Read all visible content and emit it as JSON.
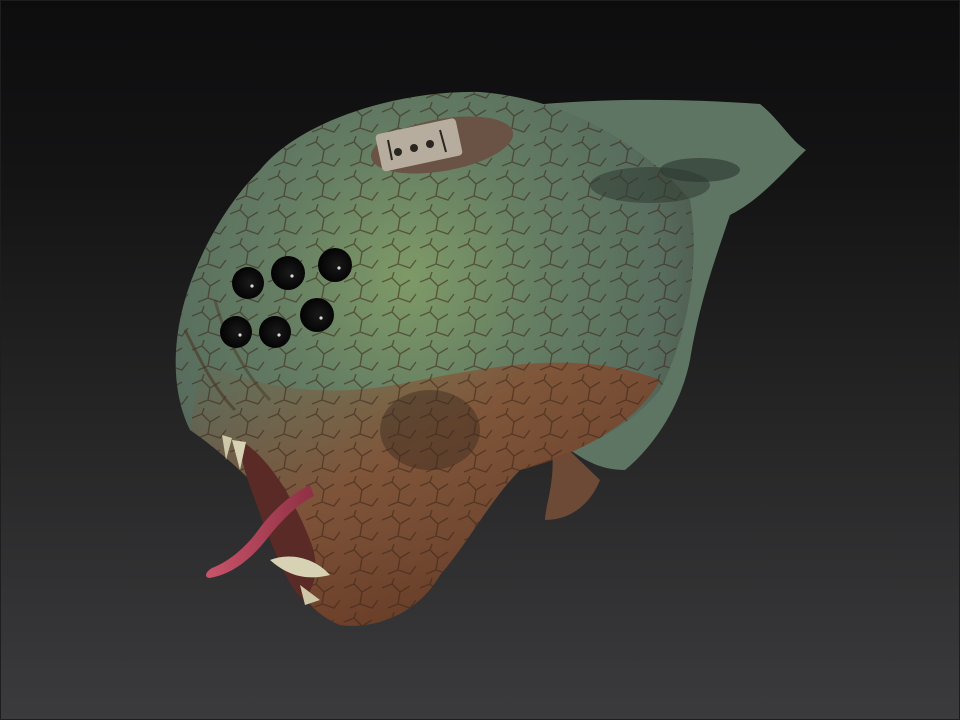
{
  "scene": {
    "subject": "creature-head-sculpt",
    "background": {
      "top": "#0d0d0e",
      "bottom": "#3b3b3d"
    },
    "palette": {
      "skin_green": "#6f8a5a",
      "skin_teal": "#5d7b6f",
      "skin_rust": "#7a3e25",
      "crack_dark": "#2a1a12",
      "eye_black": "#0a0a0a",
      "tongue": "#b5485a",
      "tooth": "#d8d2b4",
      "plate_metal": "#a39a8c"
    },
    "eye_count": 6
  }
}
